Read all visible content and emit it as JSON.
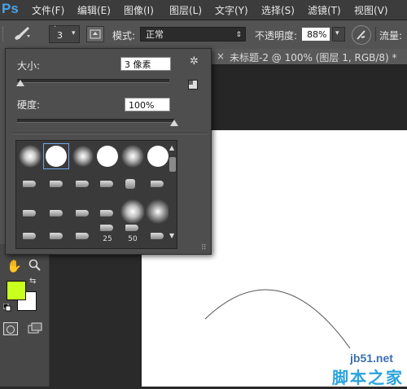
{
  "app": {
    "logo": "Ps"
  },
  "menu": [
    "文件(F)",
    "编辑(E)",
    "图像(I)",
    "图层(L)",
    "文字(Y)",
    "选择(S)",
    "滤镜(T)",
    "视图(V)"
  ],
  "options_bar": {
    "brush_size": "3",
    "mode_label": "模式:",
    "mode_value": "正常",
    "opacity_label": "不透明度:",
    "opacity_value": "88%",
    "flow_label": "流量:"
  },
  "document_tab": {
    "close": "×",
    "title": "未标题-2 @ 100% (图层 1, RGB/8) *"
  },
  "brush_popup": {
    "size_label": "大小:",
    "size_value": "3 像素",
    "size_level": 0.02,
    "hardness_label": "硬度:",
    "hardness_value": "100%",
    "hardness_level": 1.0,
    "brush_labels": [
      "25",
      "50"
    ]
  },
  "colors": {
    "foreground": "#c8ff1e",
    "background": "#ffffff",
    "accent": "#4aa2e8"
  },
  "watermark": {
    "site": "jb51.net",
    "brand": "脚本之家"
  }
}
